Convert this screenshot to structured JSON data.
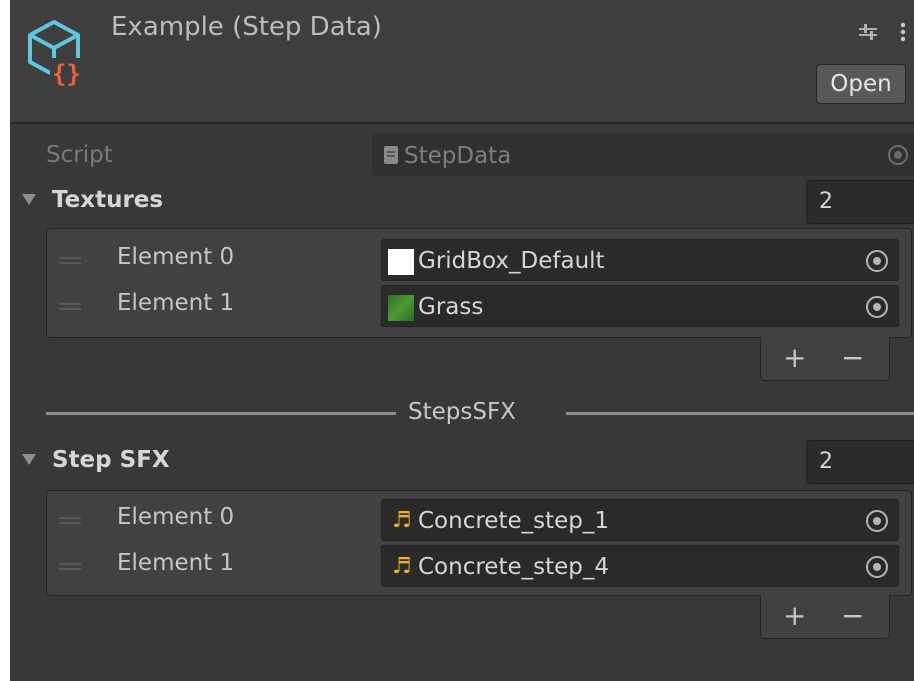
{
  "header": {
    "title": "Example (Step Data)",
    "open_label": "Open",
    "icons": [
      "scriptable-object-icon",
      "settings-sliders-icon",
      "kebab-menu-icon"
    ]
  },
  "script": {
    "label": "Script",
    "value": "StepData"
  },
  "textures": {
    "label": "Textures",
    "count": "2",
    "items": [
      {
        "label": "Element 0",
        "value": "GridBox_Default",
        "swatch": "#ffffff"
      },
      {
        "label": "Element 1",
        "value": "Grass",
        "swatch": "#3f8a2a"
      }
    ],
    "add_label": "+",
    "remove_label": "−"
  },
  "separator": {
    "label": "StepsSFX"
  },
  "step_sfx": {
    "label": "Step SFX",
    "count": "2",
    "items": [
      {
        "label": "Element 0",
        "value": "Concrete_step_1"
      },
      {
        "label": "Element 1",
        "value": "Concrete_step_4"
      }
    ],
    "audio_glyph": "♬",
    "add_label": "+",
    "remove_label": "−"
  },
  "colors": {
    "background": "#383838",
    "header": "#3e3e3e",
    "field": "#2a2a2a",
    "audio_icon": "#f0b21e",
    "icon_cyan": "#5fc6e0",
    "icon_orange": "#e8643c"
  }
}
